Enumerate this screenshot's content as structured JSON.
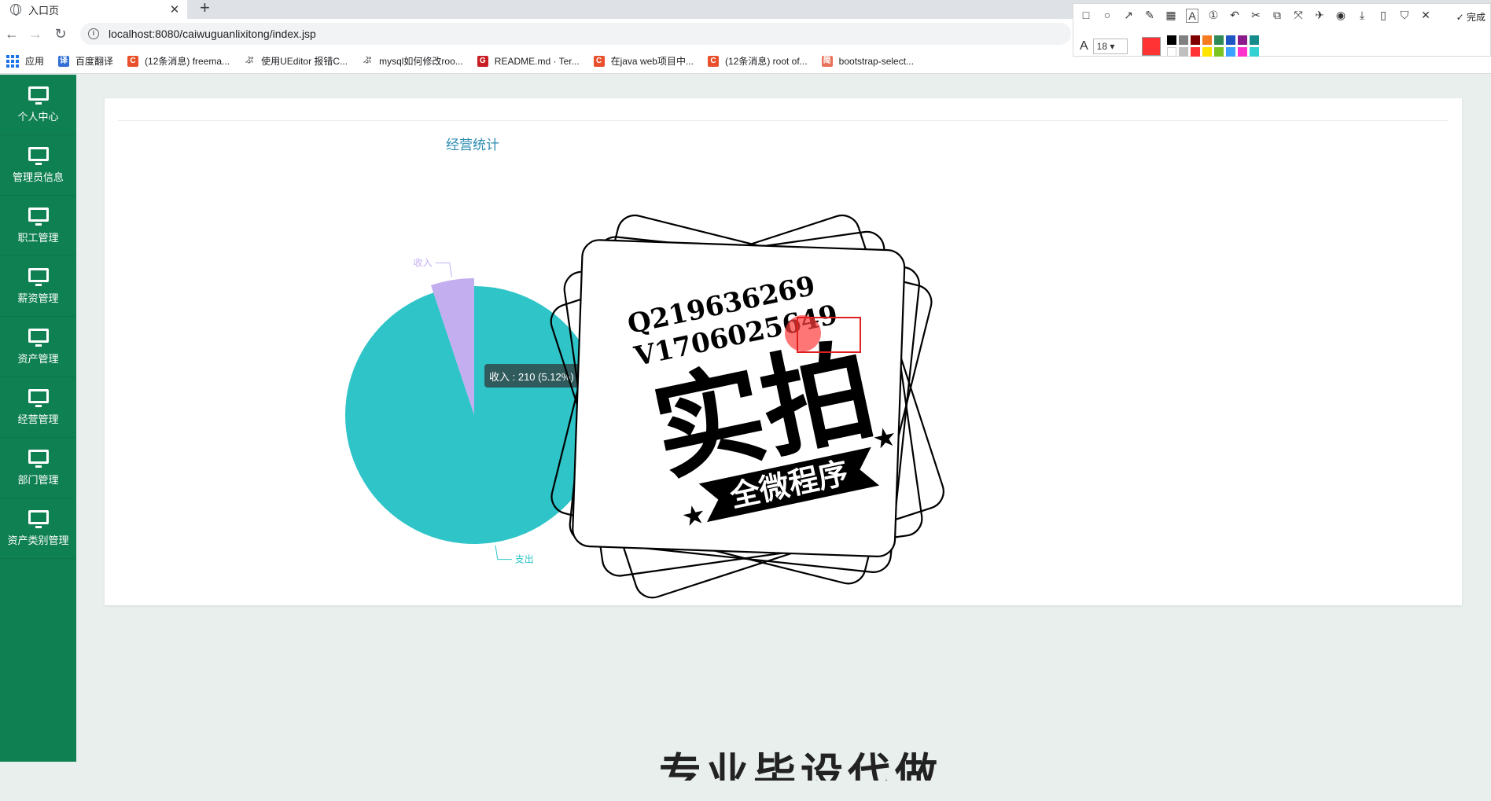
{
  "browser": {
    "tab_title": "入口页",
    "url": "localhost:8080/caiwuguanlixitong/index.jsp",
    "bookmarks": [
      {
        "label": "应用",
        "icon": "apps-grid-icon"
      },
      {
        "label": "百度翻译",
        "icon": "baidu-translate-icon",
        "color": "#2f6fd6",
        "glyph": "译"
      },
      {
        "label": "(12条消息) freema...",
        "icon": "csdn-icon",
        "color": "#e7502a",
        "glyph": "C"
      },
      {
        "label": "使用UEditor 报错C...",
        "icon": "page-icon",
        "color": "#666666",
        "glyph": "ぷ"
      },
      {
        "label": "mysql如何修改roo...",
        "icon": "page-icon",
        "color": "#666666",
        "glyph": "ぷ"
      },
      {
        "label": "README.md · Ter...",
        "icon": "gitee-icon",
        "color": "#c71d23",
        "glyph": "G"
      },
      {
        "label": "在java web项目中...",
        "icon": "csdn-icon",
        "color": "#e7502a",
        "glyph": "C"
      },
      {
        "label": "(12条消息) root of...",
        "icon": "csdn-icon",
        "color": "#e7502a",
        "glyph": "C"
      },
      {
        "label": "bootstrap-select...",
        "icon": "jianshu-icon",
        "color": "#e9725a",
        "glyph": "简"
      }
    ]
  },
  "capture_toolbar": {
    "done_label": "完成",
    "font_size": "18",
    "tools": [
      "rectangle-icon",
      "ellipse-icon",
      "arrow-icon",
      "pen-icon",
      "mosaic-icon",
      "text-icon",
      "number-icon",
      "undo-icon",
      "tool-a-icon",
      "tool-b-icon",
      "tool-c-icon",
      "pin-icon",
      "record-icon",
      "download-icon",
      "phone-icon",
      "bookmark-icon",
      "close-icon"
    ],
    "active_color": "#ff3333",
    "palette": [
      "#000000",
      "#808080",
      "#800000",
      "#f57c20",
      "#2e8b57",
      "#1e55c5",
      "#8b1a8b",
      "#168b8b",
      "#ffffff",
      "#c0c0c0",
      "#ff3333",
      "#ffe400",
      "#7cc41f",
      "#3ba1ff",
      "#ff33cc",
      "#33d1d1"
    ]
  },
  "sidebar": {
    "items": [
      {
        "label": "个人中心"
      },
      {
        "label": "管理员信息"
      },
      {
        "label": "职工管理"
      },
      {
        "label": "薪资管理"
      },
      {
        "label": "资产管理"
      },
      {
        "label": "经营管理"
      },
      {
        "label": "部门管理"
      },
      {
        "label": "资产类别管理"
      }
    ]
  },
  "main": {
    "chart_title": "经营统计",
    "bottom_heading": "专业毕设代做"
  },
  "chart_data": {
    "type": "pie",
    "title": "经营统计",
    "slices": [
      {
        "name": "收入",
        "value": 210,
        "percent": 5.12,
        "color": "#c3aef0"
      },
      {
        "name": "支出",
        "value": 3891,
        "percent": 94.88,
        "color": "#2ec4c8"
      }
    ],
    "tooltip": "收入 : 210 (5.12%)",
    "highlighted": "收入"
  },
  "stamp": {
    "line1": "Q219636269",
    "line2": "V1706025649",
    "big_text": "实拍",
    "banner_text": "全微程序"
  }
}
